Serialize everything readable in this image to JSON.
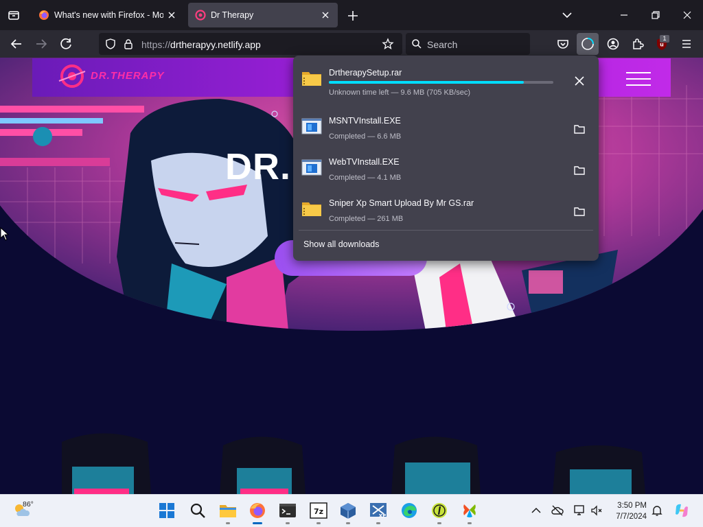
{
  "browser": {
    "tabs": [
      {
        "title": "What's new with Firefox - More",
        "active": false
      },
      {
        "title": "Dr Therapy",
        "active": true
      }
    ],
    "url": {
      "scheme": "https://",
      "host": "drtherapyy.netlify.app"
    },
    "search_placeholder": "Search",
    "extension_badge_count": "1"
  },
  "page": {
    "hero_title": "DR."
  },
  "downloads": {
    "items": [
      {
        "name": "DrtherapySetup.rar",
        "status": "Unknown time left — 9.6 MB (705 KB/sec)",
        "state": "in_progress",
        "progress": 0.87,
        "type": "archive-icon"
      },
      {
        "name": "MSNTVInstall.EXE",
        "status": "Completed — 6.6 MB",
        "state": "completed",
        "type": "exe-icon"
      },
      {
        "name": "WebTVInstall.EXE",
        "status": "Completed — 4.1 MB",
        "state": "completed",
        "type": "exe-icon"
      },
      {
        "name": "Sniper Xp Smart Upload By Mr GS.rar",
        "status": "Completed — 261 MB",
        "state": "completed",
        "type": "archive-icon"
      }
    ],
    "show_all_label": "Show all downloads"
  },
  "taskbar": {
    "weather_temp": "86°",
    "time": "3:50 PM",
    "date": "7/7/2024"
  },
  "colors": {
    "accent": "#00ddff",
    "panel_bg": "#42414d",
    "toolbar_bg": "#2b2a33",
    "tabstrip_bg": "#1c1b22",
    "page_bg": "#0b0a33"
  }
}
